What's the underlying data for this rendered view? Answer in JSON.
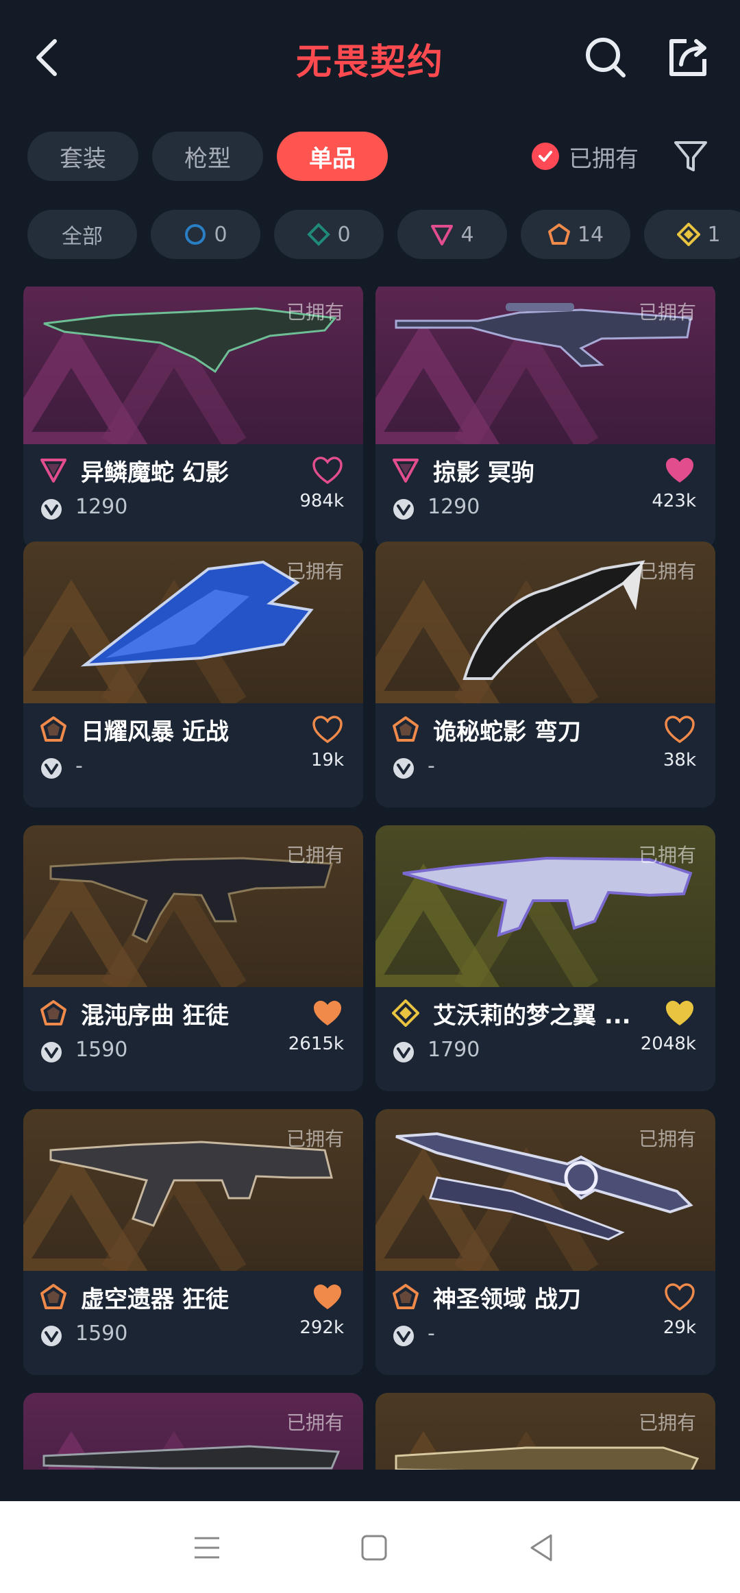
{
  "header": {
    "title": "无畏契约",
    "back_icon": "chevron-left-icon",
    "search_icon": "search-icon",
    "share_icon": "share-icon"
  },
  "tabs": [
    {
      "label": "套装",
      "active": false
    },
    {
      "label": "枪型",
      "active": false
    },
    {
      "label": "单品",
      "active": true
    }
  ],
  "owned_filter": {
    "label": "已拥有",
    "checked": true
  },
  "filter_icon": "funnel-icon",
  "tier_filters": [
    {
      "label": "全部",
      "icon": ""
    },
    {
      "label": "0",
      "icon": "select-tier-icon",
      "color": "#2a7fc4"
    },
    {
      "label": "0",
      "icon": "deluxe-tier-icon",
      "color": "#1f8a7a"
    },
    {
      "label": "4",
      "icon": "premium-tier-icon",
      "color": "#e24d8e"
    },
    {
      "label": "14",
      "icon": "exclusive-tier-icon",
      "color": "#f08a4b"
    },
    {
      "label": "1",
      "icon": "ultra-tier-icon",
      "color": "#e8c440"
    }
  ],
  "colors": {
    "accent": "#ff5551",
    "purple_tier": "#e24d8e",
    "orange_tier": "#f08a4b",
    "gold_tier": "#e8c440"
  },
  "items": [
    {
      "name": "异鳞魔蛇 幻影",
      "price": "1290",
      "likes": "984k",
      "tier": "premium",
      "favorited": false,
      "owned": "已拥有",
      "img": "tier-purple"
    },
    {
      "name": "掠影 冥驹",
      "price": "1290",
      "likes": "423k",
      "tier": "premium",
      "favorited": true,
      "owned": "已拥有",
      "img": "tier-purple"
    },
    {
      "name": "日耀风暴 近战",
      "price": "-",
      "likes": "19k",
      "tier": "exclusive",
      "favorited": false,
      "owned": "已拥有",
      "img": "tier-orange"
    },
    {
      "name": "诡秘蛇影 弯刀",
      "price": "-",
      "likes": "38k",
      "tier": "exclusive",
      "favorited": false,
      "owned": "已拥有",
      "img": "tier-orange"
    },
    {
      "name": "混沌序曲 狂徒",
      "price": "1590",
      "likes": "2615k",
      "tier": "exclusive",
      "favorited": true,
      "owned": "已拥有",
      "img": "tier-orange"
    },
    {
      "name": "艾沃莉的梦之翼 ...",
      "price": "1790",
      "likes": "2048k",
      "tier": "ultra",
      "favorited": true,
      "owned": "已拥有",
      "img": "tier-gold"
    },
    {
      "name": "虚空遗器 狂徒",
      "price": "1590",
      "likes": "292k",
      "tier": "exclusive",
      "favorited": true,
      "owned": "已拥有",
      "img": "tier-orange"
    },
    {
      "name": "神圣领域 战刀",
      "price": "-",
      "likes": "29k",
      "tier": "exclusive",
      "favorited": false,
      "owned": "已拥有",
      "img": "tier-orange"
    },
    {
      "name": "",
      "price": "",
      "likes": "",
      "tier": "premium",
      "favorited": false,
      "owned": "已拥有",
      "img": "tier-purple"
    },
    {
      "name": "",
      "price": "",
      "likes": "",
      "tier": "exclusive",
      "favorited": false,
      "owned": "已拥有",
      "img": "tier-orange"
    }
  ],
  "nav": {
    "menu_icon": "menu-icon",
    "home_icon": "home-square-icon",
    "back_icon": "back-triangle-icon"
  }
}
